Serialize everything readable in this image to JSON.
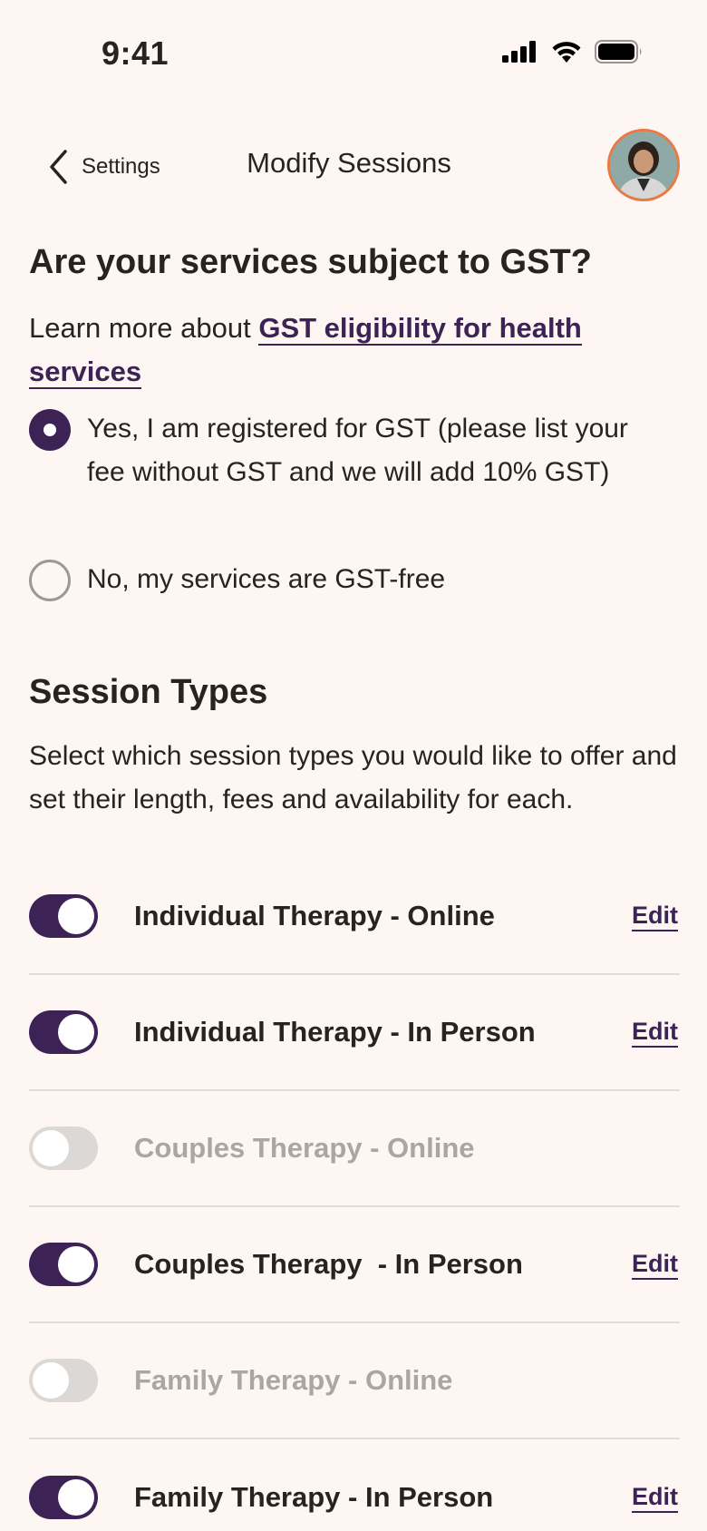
{
  "status_bar": {
    "time": "9:41"
  },
  "nav": {
    "back_label": "Settings",
    "title": "Modify Sessions"
  },
  "gst": {
    "heading": "Are your services subject to GST?",
    "learn_prefix": "Learn more about ",
    "learn_link": "GST eligibility for health services",
    "options": [
      {
        "label": "Yes, I am registered for GST (please list your fee without GST and we will add 10% GST)",
        "selected": true
      },
      {
        "label": "No, my services are GST-free",
        "selected": false
      }
    ]
  },
  "sessions": {
    "heading": "Session Types",
    "description": "Select which session types you would like to offer and set their length, fees and availability for each.",
    "edit_label": "Edit",
    "items": [
      {
        "label": "Individual Therapy - Online",
        "enabled": true
      },
      {
        "label": "Individual Therapy - In Person",
        "enabled": true
      },
      {
        "label": "Couples Therapy - Online",
        "enabled": false
      },
      {
        "label": "Couples Therapy  - In Person",
        "enabled": true
      },
      {
        "label": "Family Therapy - Online",
        "enabled": false
      },
      {
        "label": "Family Therapy - In Person",
        "enabled": true
      }
    ]
  },
  "colors": {
    "accent": "#3d2255",
    "background": "#fdf6f3",
    "avatar_border": "#e77a45"
  }
}
